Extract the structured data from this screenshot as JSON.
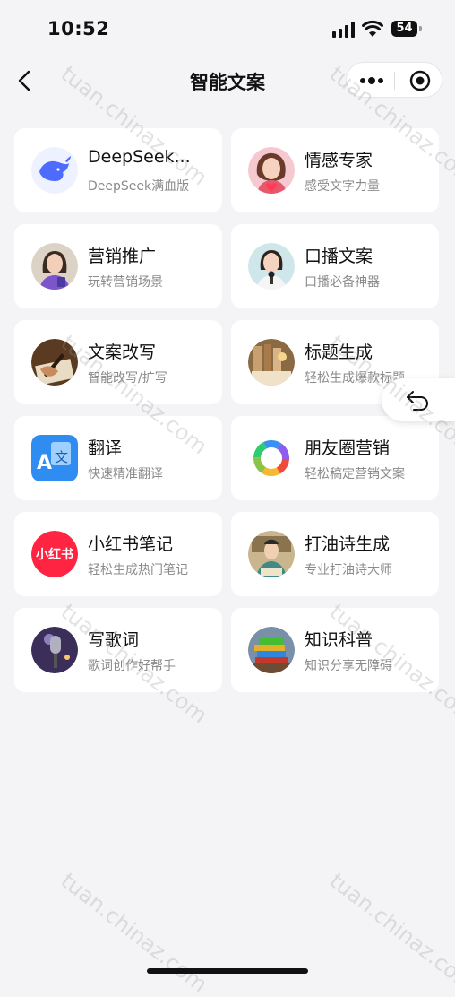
{
  "status": {
    "time": "10:52",
    "battery": "54"
  },
  "nav": {
    "title": "智能文案"
  },
  "watermark": "tuan.chinaz.com",
  "cards": [
    {
      "name": "DeepSeek...",
      "desc": "DeepSeek满血版",
      "icon": "deepseek-whale-icon"
    },
    {
      "name": "情感专家",
      "desc": "感受文字力量",
      "icon": "emotion-expert-avatar"
    },
    {
      "name": "营销推广",
      "desc": "玩转营销场景",
      "icon": "marketing-avatar"
    },
    {
      "name": "口播文案",
      "desc": "口播必备神器",
      "icon": "voiceover-avatar"
    },
    {
      "name": "文案改写",
      "desc": "智能改写/扩写",
      "icon": "rewrite-avatar"
    },
    {
      "name": "标题生成",
      "desc": "轻松生成爆款标题",
      "icon": "title-gen-avatar"
    },
    {
      "name": "翻译",
      "desc": "快速精准翻译",
      "icon": "translate-icon"
    },
    {
      "name": "朋友圈营销",
      "desc": "轻松稿定营销文案",
      "icon": "moments-ring-icon"
    },
    {
      "name": "小红书笔记",
      "desc": "轻松生成热门笔记",
      "icon": "xiaohongshu-icon",
      "badge": "小红书"
    },
    {
      "name": "打油诗生成",
      "desc": "专业打油诗大师",
      "icon": "poem-avatar"
    },
    {
      "name": "写歌词",
      "desc": "歌词创作好帮手",
      "icon": "lyrics-microphone-avatar"
    },
    {
      "name": "知识科普",
      "desc": "知识分享无障碍",
      "icon": "books-avatar"
    }
  ]
}
